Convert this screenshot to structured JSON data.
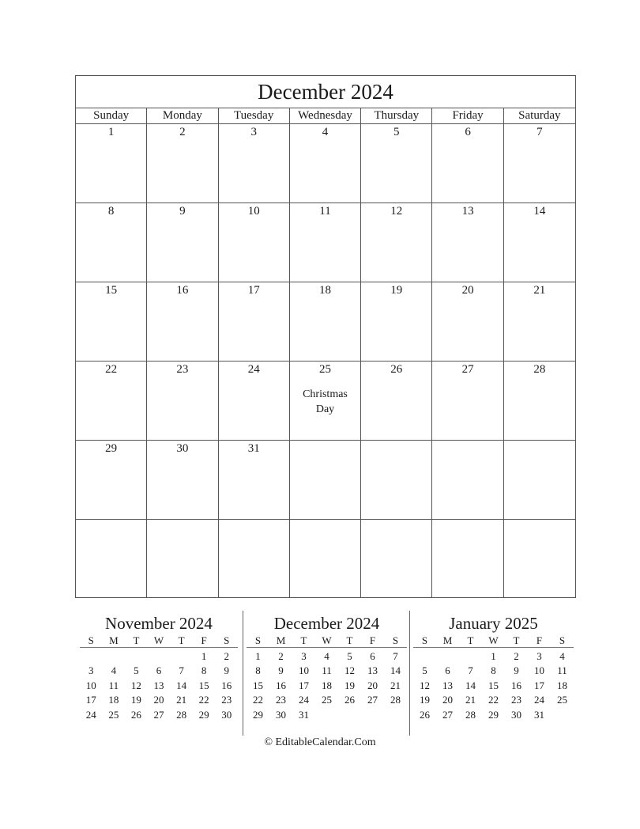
{
  "main": {
    "title": "December 2024",
    "weekdays": [
      "Sunday",
      "Monday",
      "Tuesday",
      "Wednesday",
      "Thursday",
      "Friday",
      "Saturday"
    ],
    "weeks": [
      [
        {
          "d": "1"
        },
        {
          "d": "2"
        },
        {
          "d": "3"
        },
        {
          "d": "4"
        },
        {
          "d": "5"
        },
        {
          "d": "6"
        },
        {
          "d": "7"
        }
      ],
      [
        {
          "d": "8"
        },
        {
          "d": "9"
        },
        {
          "d": "10"
        },
        {
          "d": "11"
        },
        {
          "d": "12"
        },
        {
          "d": "13"
        },
        {
          "d": "14"
        }
      ],
      [
        {
          "d": "15"
        },
        {
          "d": "16"
        },
        {
          "d": "17"
        },
        {
          "d": "18"
        },
        {
          "d": "19"
        },
        {
          "d": "20"
        },
        {
          "d": "21"
        }
      ],
      [
        {
          "d": "22"
        },
        {
          "d": "23"
        },
        {
          "d": "24"
        },
        {
          "d": "25",
          "event": "Christmas Day"
        },
        {
          "d": "26"
        },
        {
          "d": "27"
        },
        {
          "d": "28"
        }
      ],
      [
        {
          "d": "29"
        },
        {
          "d": "30"
        },
        {
          "d": "31"
        },
        {
          "d": ""
        },
        {
          "d": ""
        },
        {
          "d": ""
        },
        {
          "d": ""
        }
      ],
      [
        {
          "d": ""
        },
        {
          "d": ""
        },
        {
          "d": ""
        },
        {
          "d": ""
        },
        {
          "d": ""
        },
        {
          "d": ""
        },
        {
          "d": ""
        }
      ]
    ]
  },
  "mini_calendars": [
    {
      "title": "November 2024",
      "weekdays": [
        "S",
        "M",
        "T",
        "W",
        "T",
        "F",
        "S"
      ],
      "days": [
        "",
        "",
        "",
        "",
        "",
        "1",
        "2",
        "3",
        "4",
        "5",
        "6",
        "7",
        "8",
        "9",
        "10",
        "11",
        "12",
        "13",
        "14",
        "15",
        "16",
        "17",
        "18",
        "19",
        "20",
        "21",
        "22",
        "23",
        "24",
        "25",
        "26",
        "27",
        "28",
        "29",
        "30"
      ]
    },
    {
      "title": "December 2024",
      "weekdays": [
        "S",
        "M",
        "T",
        "W",
        "T",
        "F",
        "S"
      ],
      "days": [
        "1",
        "2",
        "3",
        "4",
        "5",
        "6",
        "7",
        "8",
        "9",
        "10",
        "11",
        "12",
        "13",
        "14",
        "15",
        "16",
        "17",
        "18",
        "19",
        "20",
        "21",
        "22",
        "23",
        "24",
        "25",
        "26",
        "27",
        "28",
        "29",
        "30",
        "31"
      ]
    },
    {
      "title": "January 2025",
      "weekdays": [
        "S",
        "M",
        "T",
        "W",
        "T",
        "F",
        "S"
      ],
      "days": [
        "",
        "",
        "",
        "1",
        "2",
        "3",
        "4",
        "5",
        "6",
        "7",
        "8",
        "9",
        "10",
        "11",
        "12",
        "13",
        "14",
        "15",
        "16",
        "17",
        "18",
        "19",
        "20",
        "21",
        "22",
        "23",
        "24",
        "25",
        "26",
        "27",
        "28",
        "29",
        "30",
        "31"
      ]
    }
  ],
  "footer": "© EditableCalendar.Com"
}
